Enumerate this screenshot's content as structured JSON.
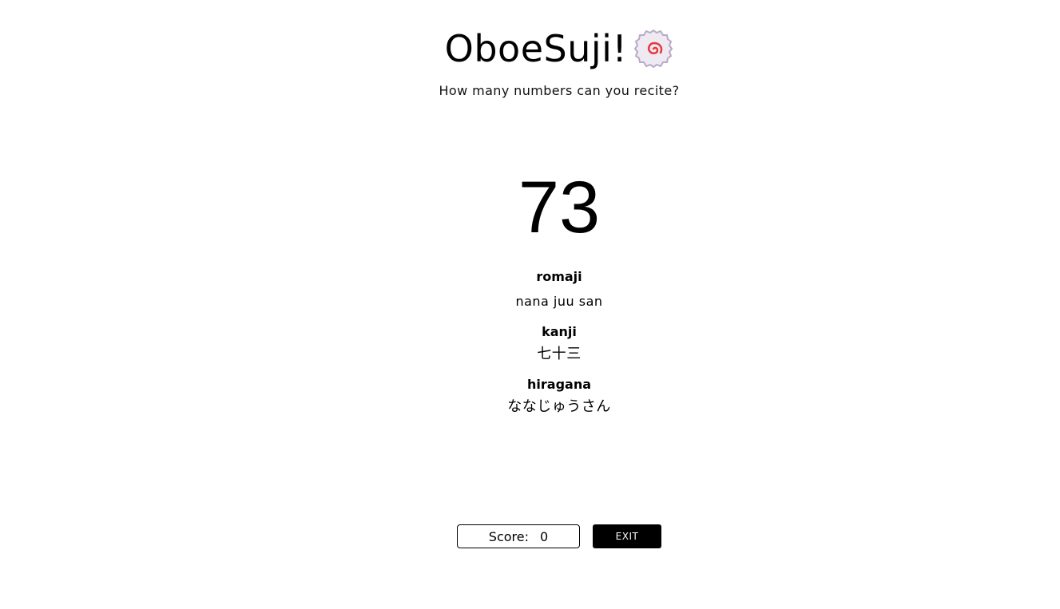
{
  "header": {
    "title": "OboeSuji!",
    "logo_icon": "narutomaki-icon",
    "subtitle": "How many numbers can you recite?"
  },
  "number": {
    "value": "73"
  },
  "readings": [
    {
      "label": "romaji",
      "value": "nana juu san"
    },
    {
      "label": "kanji",
      "value": "七十三"
    },
    {
      "label": "hiragana",
      "value": "ななじゅうさん"
    }
  ],
  "controls": {
    "score_label": "Score:",
    "score_value": "0",
    "exit_label": "EXIT"
  },
  "colors": {
    "background": "#ffffff",
    "text": "#000000",
    "button_bg": "#000000",
    "button_text": "#ffffff",
    "naruto_swirl": "#e8383d"
  }
}
